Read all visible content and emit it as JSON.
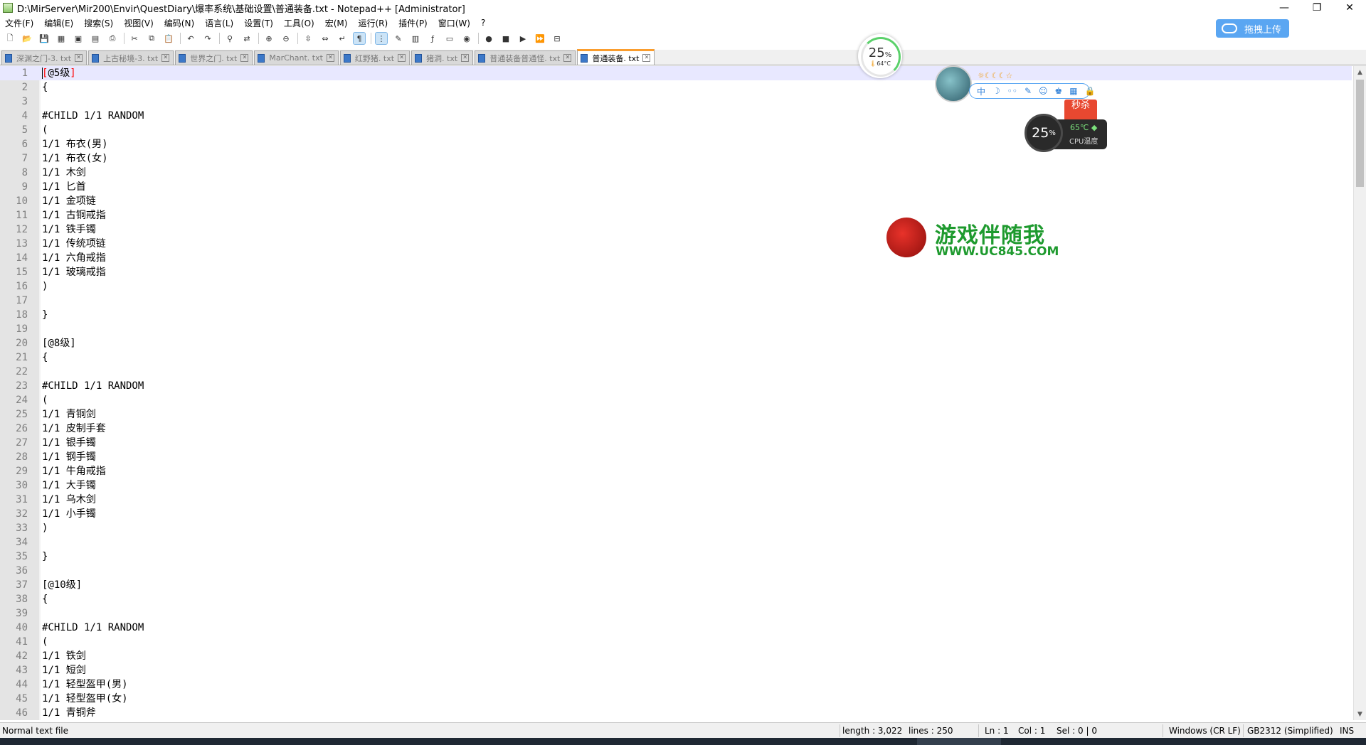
{
  "window": {
    "title": "D:\\MirServer\\Mir200\\Envir\\QuestDiary\\爆率系统\\基础设置\\普通装备.txt - Notepad++ [Administrator]",
    "minimize": "—",
    "maximize": "❐",
    "close": "✕"
  },
  "upload_button": {
    "label": "拖拽上传"
  },
  "menu": [
    "文件(F)",
    "编辑(E)",
    "搜索(S)",
    "视图(V)",
    "编码(N)",
    "语言(L)",
    "设置(T)",
    "工具(O)",
    "宏(M)",
    "运行(R)",
    "插件(P)",
    "窗口(W)",
    "?"
  ],
  "toolbar": {
    "groups": [
      [
        "new-file-icon",
        "open-file-icon",
        "save-icon",
        "save-all-icon",
        "close-icon",
        "close-all-icon",
        "print-icon"
      ],
      [
        "cut-icon",
        "copy-icon",
        "paste-icon"
      ],
      [
        "undo-icon",
        "redo-icon"
      ],
      [
        "find-icon",
        "replace-icon"
      ],
      [
        "zoom-in-icon",
        "zoom-out-icon"
      ],
      [
        "sync-vertical-icon",
        "sync-horizontal-icon",
        "word-wrap-icon",
        "show-all-chars-icon"
      ],
      [
        "indent-guide-icon",
        "user-language-icon",
        "doc-map-icon",
        "function-list-icon",
        "folder-workspace-icon",
        "monitor-icon"
      ],
      [
        "record-macro-icon",
        "stop-macro-icon",
        "play-macro-icon",
        "run-macro-multiple-icon",
        "save-macro-icon"
      ]
    ],
    "glyphs": {
      "new-file-icon": "🗋",
      "open-file-icon": "📂",
      "save-icon": "💾",
      "save-all-icon": "▦",
      "close-icon": "▣",
      "close-all-icon": "▤",
      "print-icon": "⎙",
      "cut-icon": "✂",
      "copy-icon": "⧉",
      "paste-icon": "📋",
      "undo-icon": "↶",
      "redo-icon": "↷",
      "find-icon": "⚲",
      "replace-icon": "⇄",
      "zoom-in-icon": "⊕",
      "zoom-out-icon": "⊖",
      "sync-vertical-icon": "⇳",
      "sync-horizontal-icon": "⇔",
      "word-wrap-icon": "↵",
      "show-all-chars-icon": "¶",
      "indent-guide-icon": "⋮",
      "user-language-icon": "✎",
      "doc-map-icon": "▥",
      "function-list-icon": "ƒ",
      "folder-workspace-icon": "▭",
      "monitor-icon": "◉",
      "record-macro-icon": "●",
      "stop-macro-icon": "■",
      "play-macro-icon": "▶",
      "run-macro-multiple-icon": "⏩",
      "save-macro-icon": "⊟"
    }
  },
  "tabs": [
    {
      "label": "深渊之门-3. txt",
      "active": false
    },
    {
      "label": "上古秘境-3. txt",
      "active": false
    },
    {
      "label": "世界之门. txt",
      "active": false
    },
    {
      "label": "MarChant. txt",
      "active": false
    },
    {
      "label": "红野猪. txt",
      "active": false
    },
    {
      "label": "猪洞. txt",
      "active": false
    },
    {
      "label": "普通装备普通怪. txt",
      "active": false
    },
    {
      "label": "普通装备. txt",
      "active": true
    }
  ],
  "editor": {
    "current_line": 1,
    "lines": [
      "[@5级]",
      "{",
      "",
      "#CHILD 1/1 RANDOM",
      "(",
      "1/1 布衣(男)",
      "1/1 布衣(女)",
      "1/1 木剑",
      "1/1 匕首",
      "1/1 金项链",
      "1/1 古铜戒指",
      "1/1 铁手镯",
      "1/1 传统项链",
      "1/1 六角戒指",
      "1/1 玻璃戒指",
      ")",
      "",
      "}",
      "",
      "[@8级]",
      "{",
      "",
      "#CHILD 1/1 RANDOM",
      "(",
      "1/1 青铜剑",
      "1/1 皮制手套",
      "1/1 银手镯",
      "1/1 钢手镯",
      "1/1 牛角戒指",
      "1/1 大手镯",
      "1/1 乌木剑",
      "1/1 小手镯",
      ")",
      "",
      "}",
      "",
      "[@10级]",
      "{",
      "",
      "#CHILD 1/1 RANDOM",
      "(",
      "1/1 铁剑",
      "1/1 短剑",
      "1/1 轻型盔甲(男)",
      "1/1 轻型盔甲(女)",
      "1/1 青铜斧"
    ]
  },
  "widgets": {
    "cpu_ring": {
      "percent": "25",
      "unit": "%",
      "temp": "64°C",
      "level": 0.25
    },
    "weather_icons": "☼☾☾☾☆",
    "weather_bar": [
      "中",
      "☽",
      "◦◦",
      "✎",
      "☺",
      "♚",
      "▦",
      "🔒"
    ],
    "miaosha": "秒杀",
    "cpu_widget": {
      "percent": "25",
      "unit": "%",
      "temp": "65℃",
      "label": "CPU温度"
    },
    "watermark": {
      "title": "游戏伴随我",
      "url": "WWW.UC845.COM"
    }
  },
  "statusbar": {
    "file_type": "Normal text file",
    "length": "length : 3,022",
    "lines": "lines : 250",
    "ln": "Ln : 1",
    "col": "Col : 1",
    "sel": "Sel : 0 | 0",
    "eol": "Windows (CR LF)",
    "encoding": "GB2312 (Simplified)",
    "mode": "INS"
  }
}
